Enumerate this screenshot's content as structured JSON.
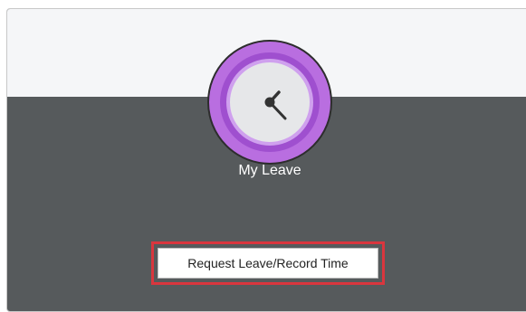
{
  "tile": {
    "title": "My Leave",
    "icon": "clock-icon",
    "action_button_label": "Request Leave/Record Time"
  },
  "colors": {
    "card_body": "#565a5c",
    "card_top": "#f5f6f8",
    "icon_ring": "#b96ee0",
    "icon_inner_ring": "#9f4fcf",
    "icon_face": "#e6e7e9",
    "highlight_border": "#d9363e",
    "title_text": "#ffffff"
  }
}
